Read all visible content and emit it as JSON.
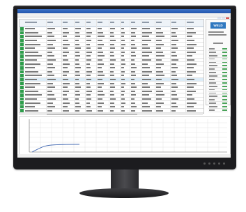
{
  "window": {
    "title": "",
    "menu": []
  },
  "logo_text": "WELD",
  "table": {
    "columns": [],
    "row_count": 30,
    "highlighted_rows": [
      13
    ]
  },
  "chart": {
    "x_label": "",
    "y_label": ""
  },
  "colors": {
    "bezel": "#1c1c1f",
    "titlebar": "#2356ad",
    "row_badge": "#2e9d4b",
    "logo": "#2f78c0",
    "curve": "#4a6fb5"
  }
}
